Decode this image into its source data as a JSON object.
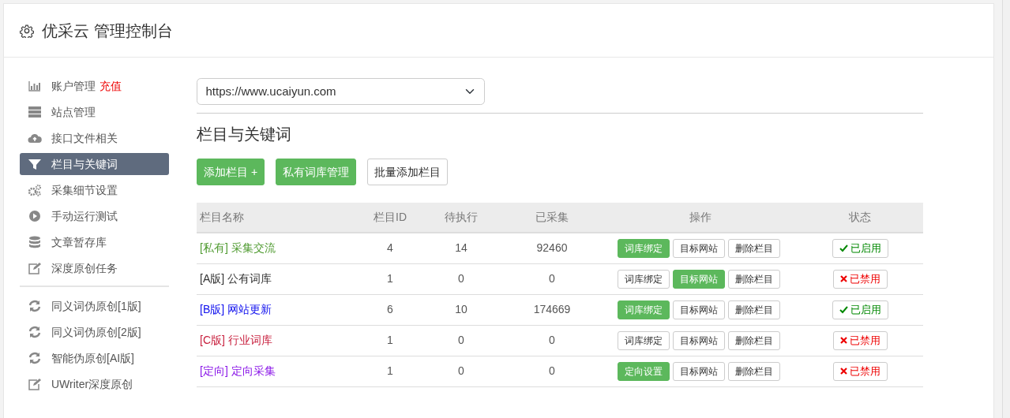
{
  "header": {
    "title": "优采云 管理控制台"
  },
  "sidebar": {
    "groups": [
      [
        {
          "label": "账户管理",
          "extra": "充值",
          "selected": false
        },
        {
          "label": "站点管理",
          "selected": false
        },
        {
          "label": "接口文件相关",
          "selected": false
        },
        {
          "label": "栏目与关键词",
          "selected": true
        },
        {
          "label": "采集细节设置",
          "selected": false
        },
        {
          "label": "手动运行测试",
          "selected": false
        },
        {
          "label": "文章暂存库",
          "selected": false
        },
        {
          "label": "深度原创任务",
          "selected": false
        }
      ],
      [
        {
          "label": "同义词伪原创[1版]",
          "selected": false
        },
        {
          "label": "同义词伪原创[2版]",
          "selected": false
        },
        {
          "label": "智能伪原创[AI版]",
          "selected": false
        },
        {
          "label": "UWriter深度原创",
          "selected": false
        }
      ]
    ]
  },
  "site_select": {
    "value": "https://www.ucaiyun.com"
  },
  "section_title": "栏目与关键词",
  "toolbar": [
    {
      "label": "添加栏目 +",
      "primary": true
    },
    {
      "label": "私有词库管理",
      "primary": true
    },
    {
      "label": "批量添加栏目",
      "primary": false
    }
  ],
  "table": {
    "columns": [
      "栏目名称",
      "栏目ID",
      "待执行",
      "已采集",
      "操作",
      "状态"
    ],
    "rows": [
      {
        "tag": "[私有]",
        "name": "采集交流",
        "color": "#4e9a2f",
        "id": "4",
        "pending": "14",
        "collected": "92460",
        "actions": [
          {
            "label": "词库绑定",
            "active": true
          },
          {
            "label": "目标网站",
            "active": false
          },
          {
            "label": "删除栏目",
            "active": false
          }
        ],
        "status": "已启用",
        "enabled": true
      },
      {
        "tag": "[A版]",
        "name": "公有词库",
        "color": "#333333",
        "id": "1",
        "pending": "0",
        "collected": "0",
        "actions": [
          {
            "label": "词库绑定",
            "active": false
          },
          {
            "label": "目标网站",
            "active": true
          },
          {
            "label": "删除栏目",
            "active": false
          }
        ],
        "status": "已禁用",
        "enabled": false
      },
      {
        "tag": "[B版]",
        "name": "网站更新",
        "color": "#1010ee",
        "id": "6",
        "pending": "10",
        "collected": "174669",
        "actions": [
          {
            "label": "词库绑定",
            "active": true
          },
          {
            "label": "目标网站",
            "active": false
          },
          {
            "label": "删除栏目",
            "active": false
          }
        ],
        "status": "已启用",
        "enabled": true
      },
      {
        "tag": "[C版]",
        "name": "行业词库",
        "color": "#c8203e",
        "id": "1",
        "pending": "0",
        "collected": "0",
        "actions": [
          {
            "label": "词库绑定",
            "active": false
          },
          {
            "label": "目标网站",
            "active": false
          },
          {
            "label": "删除栏目",
            "active": false
          }
        ],
        "status": "已禁用",
        "enabled": false
      },
      {
        "tag": "[定向]",
        "name": "定向采集",
        "color": "#8a16e8",
        "id": "1",
        "pending": "0",
        "collected": "0",
        "actions": [
          {
            "label": "定向设置",
            "active": true
          },
          {
            "label": "目标网站",
            "active": false
          },
          {
            "label": "删除栏目",
            "active": false
          }
        ],
        "status": "已禁用",
        "enabled": false
      }
    ]
  }
}
